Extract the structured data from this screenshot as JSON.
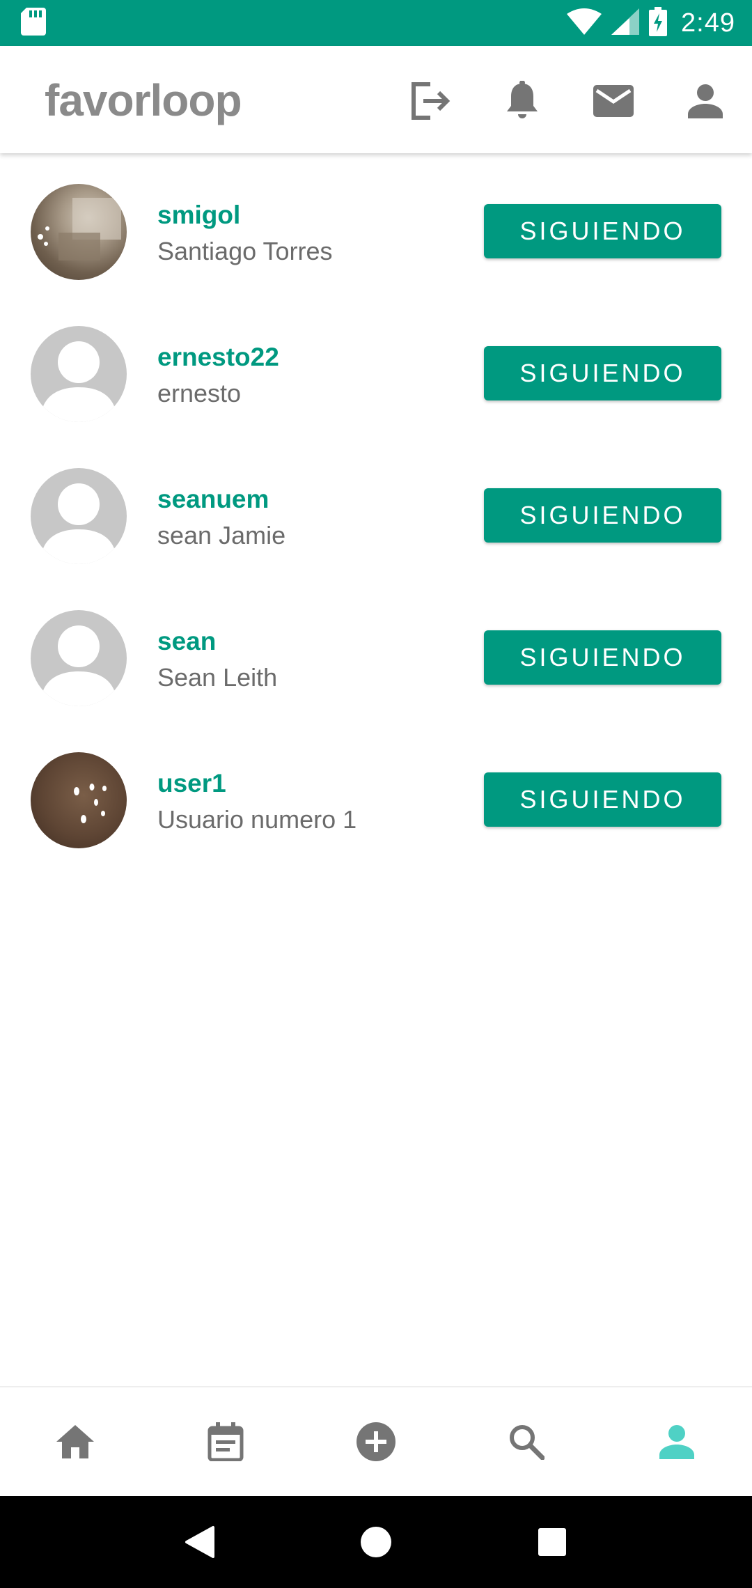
{
  "status_bar": {
    "time": "2:49",
    "icons": [
      "sd-card-icon",
      "wifi-icon",
      "signal-icon",
      "battery-charging-icon"
    ]
  },
  "header": {
    "logo": "favorloop",
    "icons": [
      "logout-icon",
      "bell-icon",
      "mail-icon",
      "profile-icon"
    ]
  },
  "colors": {
    "accent": "#009980",
    "status_bar": "#009980",
    "icon_gray": "#757575",
    "active_nav": "#4fd1c5"
  },
  "following": [
    {
      "username": "smigol",
      "full_name": "Santiago Torres",
      "button_label": "SIGUIENDO",
      "avatar": "photo"
    },
    {
      "username": "ernesto22",
      "full_name": "ernesto",
      "button_label": "SIGUIENDO",
      "avatar": "default"
    },
    {
      "username": "seanuem",
      "full_name": "sean Jamie",
      "button_label": "SIGUIENDO",
      "avatar": "default"
    },
    {
      "username": "sean",
      "full_name": "Sean Leith",
      "button_label": "SIGUIENDO",
      "avatar": "default"
    },
    {
      "username": "user1",
      "full_name": "Usuario numero 1",
      "button_label": "SIGUIENDO",
      "avatar": "photo"
    }
  ],
  "bottom_nav": {
    "items": [
      "home-icon",
      "calendar-icon",
      "add-circle-icon",
      "search-icon",
      "person-icon"
    ],
    "active": "person-icon"
  },
  "system_nav": [
    "back-icon",
    "home-circle-icon",
    "recents-icon"
  ]
}
